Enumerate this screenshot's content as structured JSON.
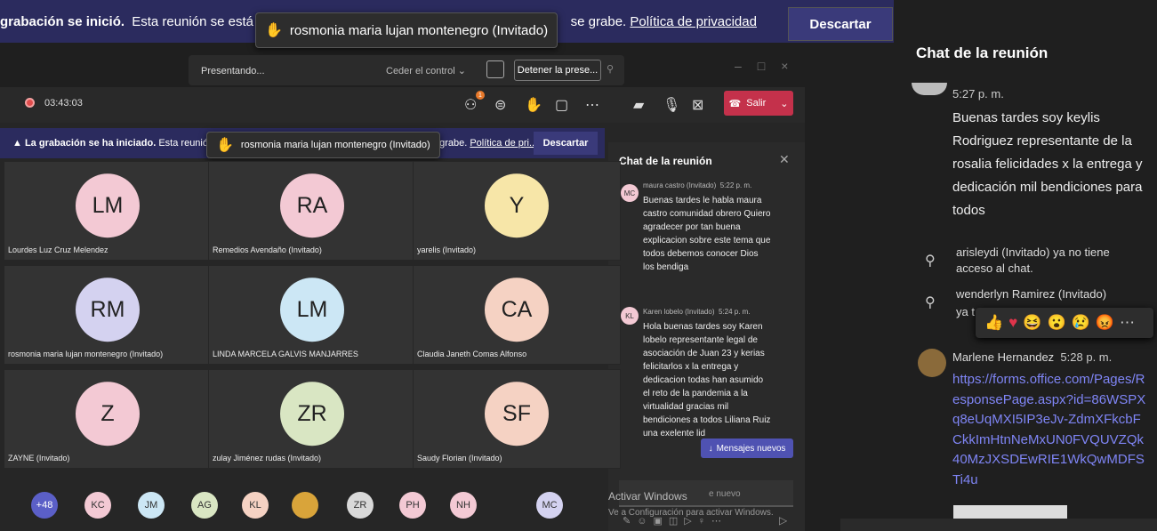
{
  "top_banner": {
    "bold": "grabación se inició.",
    "text1": "Esta reunión se está g",
    "text2": "se grabe.",
    "link": "Política de privacidad",
    "dismiss": "Descartar"
  },
  "raised_hand_tooltip": "rosmonia maria lujan montenegro (Invitado)",
  "presenting_bar": {
    "presenting": "Presentando...",
    "give_control": "Ceder el control",
    "stop": "Detener la prese..."
  },
  "meeting": {
    "timer": "03:43:03",
    "participants_badge": "1",
    "leave": "Salir"
  },
  "inner_banner": {
    "bold": "La grabación se ha iniciado.",
    "text1": "Esta reunión se",
    "text2": "que se grabe.",
    "link": "Política de pri...",
    "dismiss": "Descartar",
    "tooltip": "rosmonia maria lujan montenegro (Invitado)"
  },
  "tiles": [
    {
      "initials": "LM",
      "name": "Lourdes Luz Cruz Melendez",
      "color": "#f3c9d4"
    },
    {
      "initials": "RA",
      "name": "Remedios Avendaño (Invitado)",
      "color": "#f3c9d4"
    },
    {
      "initials": "Y",
      "name": "yarelis (Invitado)",
      "color": "#f7e6a8"
    },
    {
      "initials": "RM",
      "name": "rosmonia maria lujan montenegro (Invitado)",
      "color": "#d4d2f0"
    },
    {
      "initials": "LM",
      "name": "LINDA MARCELA GALVIS MANJARRES",
      "color": "#cce7f5"
    },
    {
      "initials": "CA",
      "name": "Claudia Janeth Comas Alfonso",
      "color": "#f5d2c3"
    },
    {
      "initials": "Z",
      "name": "ZAYNE (Invitado)",
      "color": "#f3c9d4"
    },
    {
      "initials": "ZR",
      "name": "zulay Jiménez rudas (Invitado)",
      "color": "#d9e6c3"
    },
    {
      "initials": "SF",
      "name": "Saudy Florian (Invitado)",
      "color": "#f5d2c3"
    }
  ],
  "inner_chat": {
    "title": "Chat de la reunión",
    "messages": [
      {
        "initials": "MC",
        "author": "maura castro (Invitado)",
        "time": "5:22 p. m.",
        "text": "Buenas tardes le habla maura castro comunidad obrero Quiero agradecer por tan buena explicacion sobre este tema que todos debemos conocer Dios los bendiga"
      },
      {
        "initials": "KL",
        "author": "Karen lobelo (Invitado)",
        "time": "5:24 p. m.",
        "text": "Hola buenas tardes soy Karen lobelo representante legal de asociación de Juan 23 y kerias felicitarlos x la entrega y dedicacion todas han asumido el reto de la pandemia a la virtualidad gracias mil bendiciones a todos Liliana Ruiz una exelente lid"
      }
    ],
    "new_messages": "Mensajes nuevos",
    "input_placeholder": "e nuevo",
    "watermark1": "Activar Windows",
    "watermark2": "Ve a Configuración para activar Windows."
  },
  "roster": [
    {
      "label": "+48",
      "color": "#5b5fc7"
    },
    {
      "label": "KC",
      "color": "#f3c9d4"
    },
    {
      "label": "JM",
      "color": "#cce7f5"
    },
    {
      "label": "AG",
      "color": "#d9e6c3"
    },
    {
      "label": "KL",
      "color": "#f5d2c3"
    },
    {
      "label": "",
      "color": "#d9a43a"
    },
    {
      "label": "ZR",
      "color": "#d9d9d9"
    },
    {
      "label": "PH",
      "color": "#f3c9d4"
    },
    {
      "label": "NH",
      "color": "#f3c9d4"
    },
    {
      "label": "MC",
      "color": "#d4d2f0"
    }
  ],
  "right_chat": {
    "title": "Chat de la reunión",
    "msg1_time": "5:27 p. m.",
    "msg1_text": "Buenas tardes soy keylis Rodriguez representante de la rosalia felicidades x la entrega y dedicación mil bendiciones para todos",
    "sys1": "arisleydi (Invitado) ya no tiene acceso al chat.",
    "sys2a": "wenderlyn Ramirez (Invitado)",
    "sys2b": "ya t",
    "author": "Marlene Hernandez",
    "time": "5:28 p. m.",
    "link": "https://forms.office.com/Pages/ResponsePage.aspx?id=86WSPXq8eUqMXI5IP3eJv-ZdmXFkcbFCkkImHtnNeMxUN0FVQUVZQk40MzJXSDEwRIE1WkQwMDFSTi4u"
  }
}
